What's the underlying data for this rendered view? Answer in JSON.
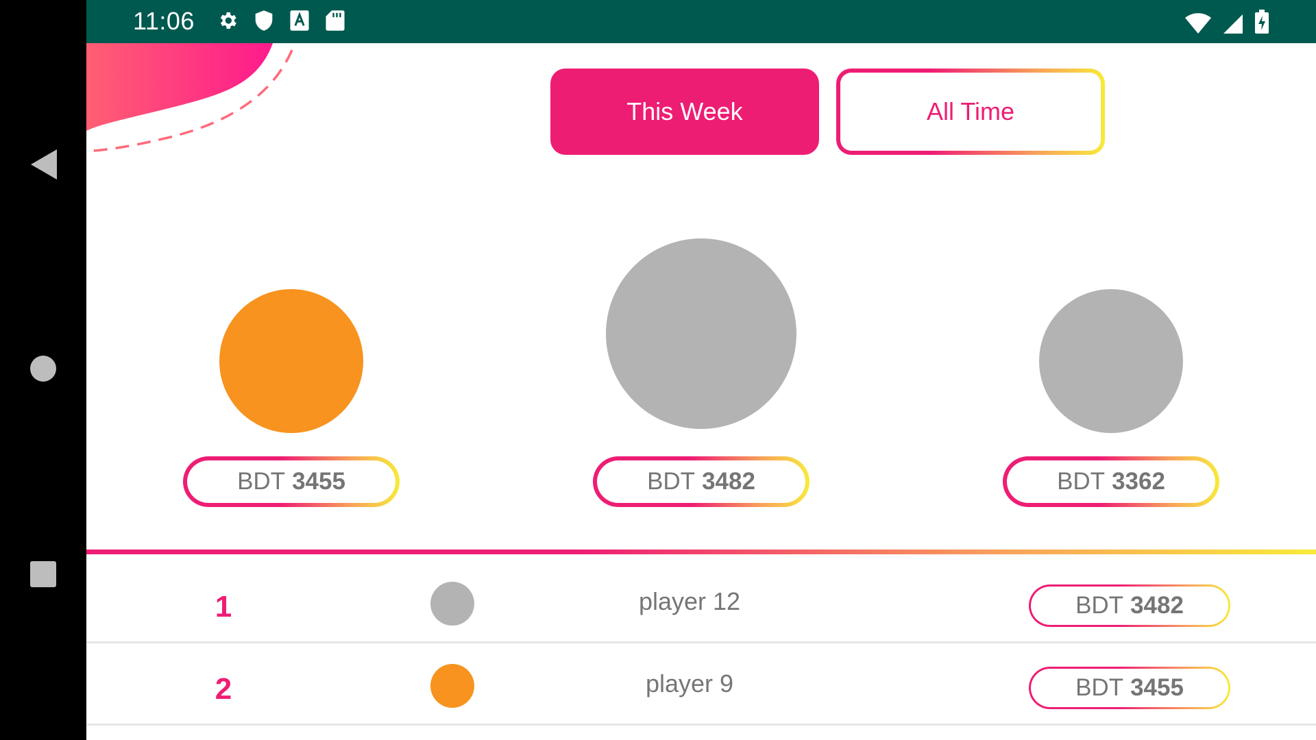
{
  "status_bar": {
    "time": "11:06",
    "left_icons": [
      "gear-icon",
      "shield-icon",
      "text-a-icon",
      "sd-card-icon"
    ],
    "right_icons": [
      "wifi-icon",
      "signal-icon",
      "battery-charging-icon"
    ]
  },
  "nav_bar": {
    "buttons": [
      "back-icon",
      "home-icon",
      "recents-icon"
    ]
  },
  "tabs": [
    {
      "label": "This Week",
      "active": true
    },
    {
      "label": "All Time",
      "active": false
    }
  ],
  "podium": [
    {
      "position": "left",
      "avatar_color": "#f7931e",
      "currency": "BDT",
      "amount": "3455"
    },
    {
      "position": "center",
      "avatar_color": "#b3b3b3",
      "currency": "BDT",
      "amount": "3482"
    },
    {
      "position": "right",
      "avatar_color": "#b3b3b3",
      "currency": "BDT",
      "amount": "3362"
    }
  ],
  "leaderboard": [
    {
      "rank": "1",
      "avatar_color": "#b3b3b3",
      "name": "player 12",
      "currency": "BDT",
      "amount": "3482"
    },
    {
      "rank": "2",
      "avatar_color": "#f7931e",
      "name": "player 9",
      "currency": "BDT",
      "amount": "3455"
    }
  ],
  "colors": {
    "accent": "#ee1d74",
    "status_bar": "#00594f",
    "gradient_end": "#f8ea3a",
    "text_gray": "#757575"
  }
}
